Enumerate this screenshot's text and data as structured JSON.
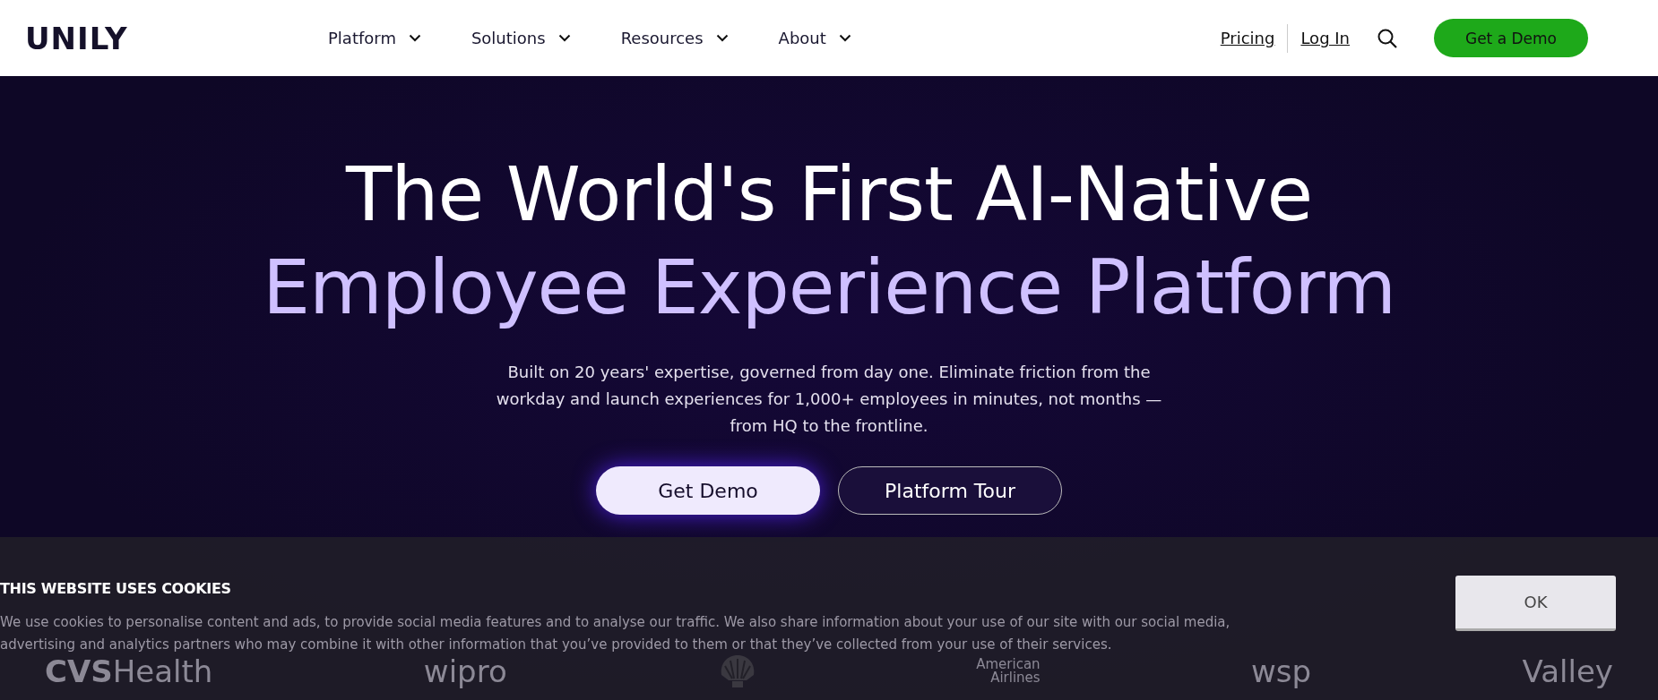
{
  "header": {
    "logo": "UNILY",
    "nav": [
      {
        "label": "Platform"
      },
      {
        "label": "Solutions"
      },
      {
        "label": "Resources"
      },
      {
        "label": "About"
      }
    ],
    "links": [
      "Pricing",
      "Log In"
    ],
    "cta": "Get a Demo"
  },
  "hero": {
    "title_line_1": "The World's First AI-Native",
    "title_line_2": "Employee Experience Platform",
    "subtitle": "Built on 20 years' expertise, governed from day one. Eliminate friction from the workday and launch experiences for 1,000+ employees in minutes, not months — from HQ to the frontline.",
    "buttons": [
      {
        "label": "Get Demo",
        "kind": "primary"
      },
      {
        "label": "Platform Tour",
        "kind": "outline"
      }
    ],
    "logos": [
      {
        "kind": "wordmark",
        "text": "**CVS**Health"
      },
      {
        "kind": "wordmark",
        "text": "wipro"
      },
      {
        "kind": "emblem"
      },
      {
        "kind": "stacked",
        "text": "American Airlines"
      },
      {
        "kind": "wordmark",
        "text": "wsp"
      },
      {
        "kind": "wordmark",
        "text": "Valley"
      }
    ]
  },
  "cookie_banner": {
    "title": "THIS WEBSITE USES COOKIES",
    "body": "We use cookies to personalise content and ads, to provide social media features and to analyse our traffic. We also share information about your use of our site with our social media, advertising and analytics partners who may combine it with other information that you’ve provided to them or that they’ve collected from your use of their services.",
    "button": "OK"
  }
}
